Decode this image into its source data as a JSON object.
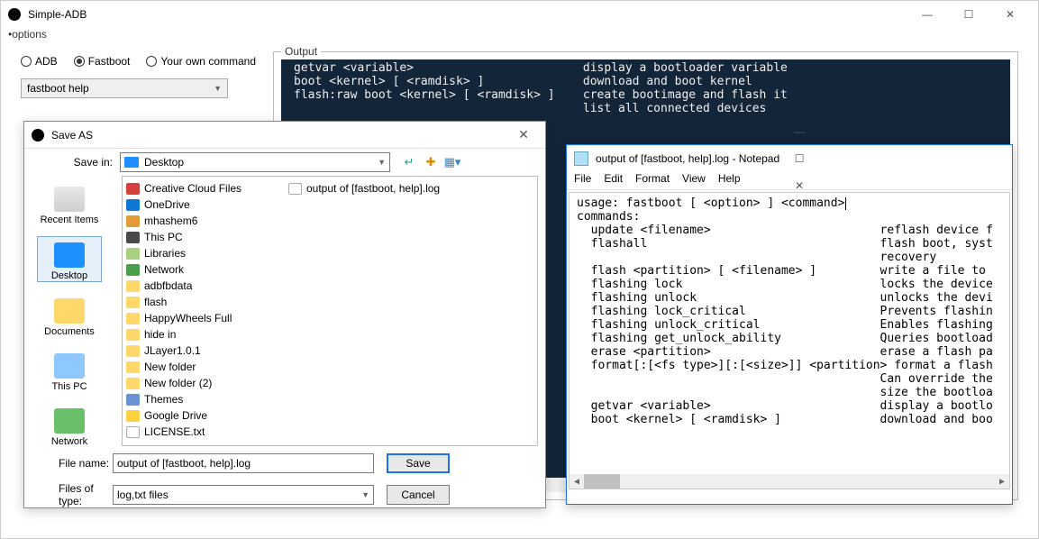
{
  "main": {
    "title": "Simple-ADB",
    "menu": "•options",
    "radios": {
      "adb": "ADB",
      "fastboot": "Fastboot",
      "own": "Your own command"
    },
    "selected_radio": "fastboot",
    "command_combo": "fastboot help",
    "output_label": "Output",
    "output_lines": "getvar <variable>                        display a bootloader variable\nboot <kernel> [ <ramdisk> ]              download and boot kernel\nflash:raw boot <kernel> [ <ramdisk> ]    create bootimage and flash it\n                                         list all connected devices"
  },
  "saveas": {
    "title": "Save AS",
    "savein_label": "Save in:",
    "savein_value": "Desktop",
    "places": {
      "recent": "Recent Items",
      "desktop": "Desktop",
      "documents": "Documents",
      "thispc": "This PC",
      "network": "Network"
    },
    "col1": [
      {
        "icon": "fi-cloud",
        "label": "Creative Cloud Files"
      },
      {
        "icon": "fi-onedrive",
        "label": "OneDrive"
      },
      {
        "icon": "fi-user",
        "label": "mhashem6"
      },
      {
        "icon": "fi-pc",
        "label": "This PC"
      },
      {
        "icon": "fi-lib",
        "label": "Libraries"
      },
      {
        "icon": "fi-net",
        "label": "Network"
      },
      {
        "icon": "fi-folder",
        "label": "adbfbdata"
      },
      {
        "icon": "fi-folder",
        "label": "flash"
      },
      {
        "icon": "fi-folder",
        "label": "HappyWheels Full"
      },
      {
        "icon": "fi-folder",
        "label": "hide in"
      },
      {
        "icon": "fi-folder",
        "label": "JLayer1.0.1"
      },
      {
        "icon": "fi-folder",
        "label": "New folder"
      },
      {
        "icon": "fi-folder",
        "label": "New folder (2)"
      },
      {
        "icon": "fi-theme",
        "label": "Themes"
      },
      {
        "icon": "fi-gdrive",
        "label": "Google Drive"
      },
      {
        "icon": "fi-file",
        "label": "LICENSE.txt"
      }
    ],
    "col2": [
      {
        "icon": "fi-log",
        "label": "output of [fastboot, help].log"
      }
    ],
    "filename_label": "File name:",
    "filename_value": "output of [fastboot, help].log",
    "filetype_label": "Files of type:",
    "filetype_value": "log,txt files",
    "save_btn": "Save",
    "cancel_btn": "Cancel"
  },
  "notepad": {
    "title": "output of [fastboot, help].log - Notepad",
    "menu": {
      "file": "File",
      "edit": "Edit",
      "format": "Format",
      "view": "View",
      "help": "Help"
    },
    "content_line1": "usage: fastboot [ <option> ] <command>",
    "content_rest": "\ncommands:\n  update <filename>                        reflash device f\n  flashall                                 flash boot, syst\n                                           recovery\n  flash <partition> [ <filename> ]         write a file to \n  flashing lock                            locks the device\n  flashing unlock                          unlocks the devi\n  flashing lock_critical                   Prevents flashin\n  flashing unlock_critical                 Enables flashing\n  flashing get_unlock_ability              Queries bootload\n  erase <partition>                        erase a flash pa\n  format[:[<fs type>][:[<size>]] <partition> format a flash\n                                           Can override the\n                                           size the bootloa\n  getvar <variable>                        display a bootlo\n  boot <kernel> [ <ramdisk> ]              download and boo"
  }
}
